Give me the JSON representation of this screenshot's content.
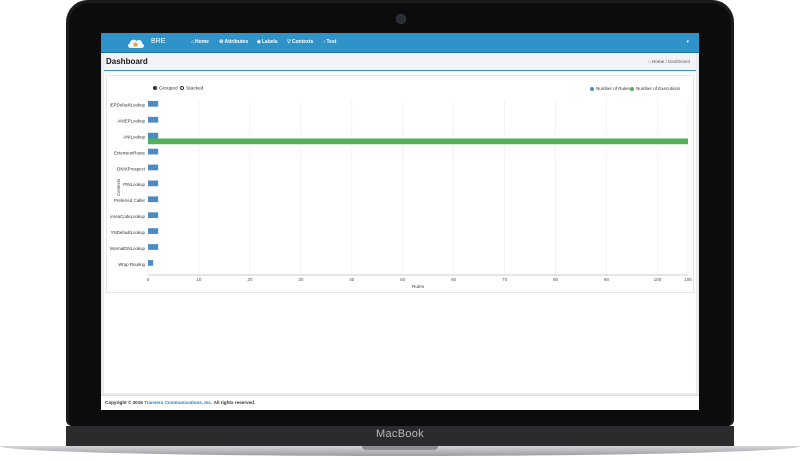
{
  "device": {
    "brand_label": "MacBook"
  },
  "app": {
    "title": "BRE",
    "nav": [
      {
        "icon": "home-icon",
        "glyph": "⌂",
        "label": "Home"
      },
      {
        "icon": "gear-icon",
        "glyph": "⚙",
        "label": "Attributes"
      },
      {
        "icon": "tag-icon",
        "glyph": "◆",
        "label": "Labels"
      },
      {
        "icon": "contexts-icon",
        "glyph": "▽",
        "label": "Contexts"
      },
      {
        "icon": "test-icon",
        "glyph": "↕",
        "label": "Test"
      }
    ],
    "user_menu_caret": "▾"
  },
  "page": {
    "title": "Dashboard",
    "breadcrumb": {
      "home": "Home",
      "separator": "/",
      "current": "Dashboard"
    }
  },
  "chart_controls": {
    "grouped_label": "Grouped",
    "stacked_label": "Stacked",
    "selected": "Grouped"
  },
  "chart_data": {
    "type": "bar",
    "orientation": "horizontal",
    "categories": [
      "IEPDefaultLookup",
      "ANIEPLookup",
      "ANILookup",
      "ExtensionRoute",
      "DNIXProspect",
      "PINLookup",
      "Preferred Caller",
      "iAreaCodeLookup",
      "YNDefaultLookup",
      "InternalDNLookup",
      "Wrap Routing"
    ],
    "series": [
      {
        "name": "Number of Rules",
        "color": "#4a8cc4",
        "values": [
          2,
          2,
          2,
          2,
          2,
          2,
          2,
          2,
          2,
          2,
          1
        ]
      },
      {
        "name": "Number of Executions",
        "color": "#52b059",
        "values": [
          0,
          0,
          106,
          0,
          0,
          0,
          0,
          0,
          0,
          0,
          0
        ]
      }
    ],
    "xlabel": "Rules",
    "ylabel": "Contexts",
    "xticks": [
      "0",
      "10",
      "20",
      "30",
      "40",
      "50",
      "60",
      "70",
      "80",
      "90",
      "100",
      "106"
    ],
    "xlim": [
      0,
      106
    ],
    "grid": true,
    "legend_position": "top-right"
  },
  "footer": {
    "prefix": "Copyright © 2015",
    "company": "Transera Communications, Inc.",
    "suffix": "All rights reserved."
  }
}
